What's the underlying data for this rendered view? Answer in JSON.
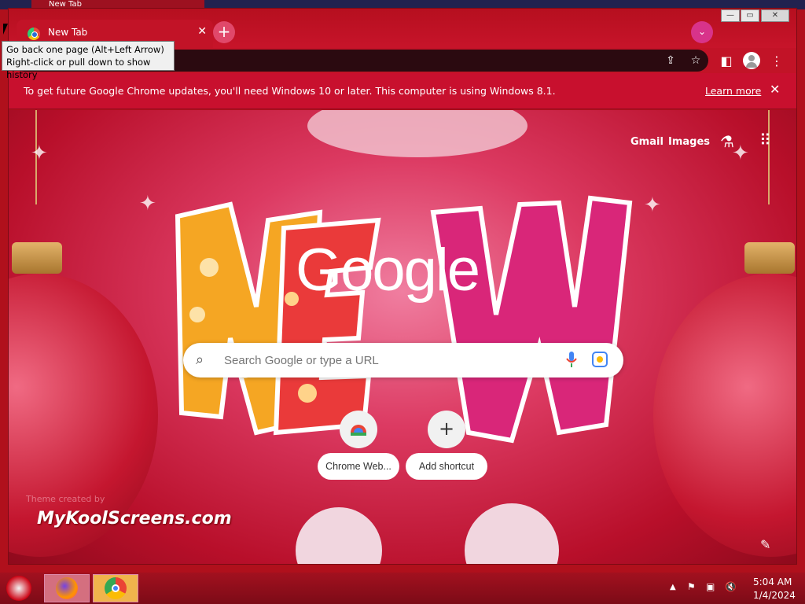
{
  "desktop": {
    "background_tab_title": "New Tab"
  },
  "browser": {
    "tab_title": "New Tab",
    "tab_close": "✕",
    "new_tab": "+",
    "tab_search": "⌄",
    "window_controls": {
      "minimize": "—",
      "maximize": "▭",
      "close": "✕"
    }
  },
  "tooltip": {
    "line1": "Go back one page (Alt+Left Arrow)",
    "line2": "Right-click or pull down to show history"
  },
  "infobar": {
    "message": "To get future Google Chrome updates, you'll need Windows 10 or later. This computer is using Windows 8.1.",
    "learn_more": "Learn more",
    "close": "✕"
  },
  "ntp": {
    "links": {
      "gmail": "Gmail",
      "images": "Images"
    },
    "logo": "Google",
    "search_placeholder": "Search Google or type a URL",
    "shortcuts": [
      {
        "label": "Chrome Web..."
      },
      {
        "label": "Add shortcut",
        "icon": "+"
      }
    ],
    "watermark": "MyKoolScreens.com",
    "credit": "Theme created by",
    "edit_icon": "✎"
  },
  "taskbar": {
    "time": "5:04 AM",
    "date": "1/4/2024"
  },
  "colors": {
    "accent": "#c21327",
    "infobar": "#c8102e",
    "omnibox": "#2b0a10",
    "taskbar": "#8e0c1a"
  }
}
